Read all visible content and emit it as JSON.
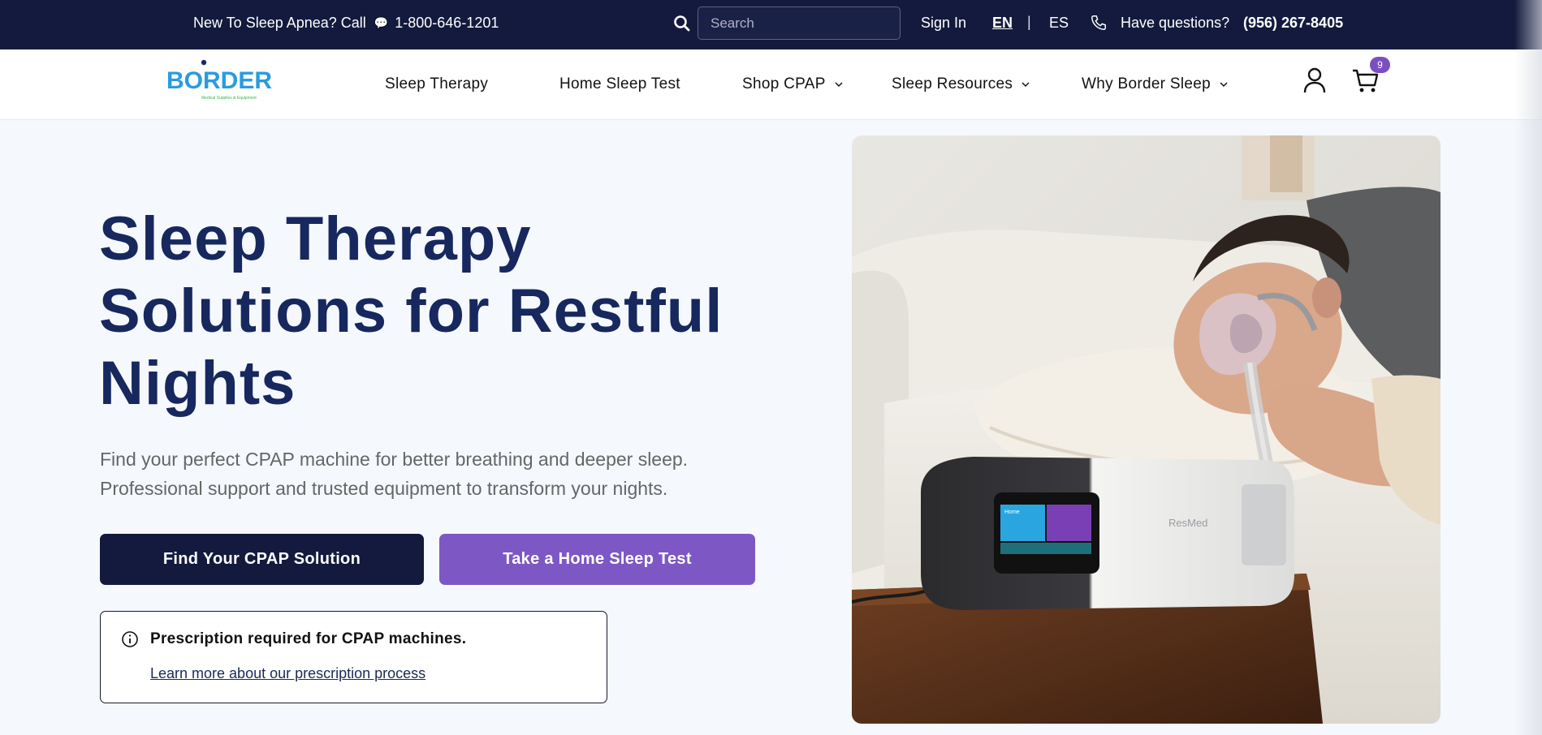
{
  "topbar": {
    "promo_text": "New To Sleep Apnea? Call",
    "promo_phone": "1-800-646-1201",
    "search_placeholder": "Search",
    "sign_in": "Sign In",
    "lang_en": "EN",
    "lang_sep": "|",
    "lang_es": "ES",
    "questions_text": "Have questions?",
    "questions_phone": "(956) 267-8405"
  },
  "nav": {
    "logo_text": "BORDER",
    "logo_tagline": "Medical Supplies & Equipment",
    "items": [
      {
        "label": "Sleep Therapy"
      },
      {
        "label": "Home Sleep Test"
      },
      {
        "label": "Shop CPAP"
      },
      {
        "label": "Sleep Resources"
      },
      {
        "label": "Why Border Sleep"
      }
    ],
    "cart_count": "9"
  },
  "hero": {
    "title_line1": "Sleep Therapy",
    "title_line2": "Solutions for Restful",
    "title_line3": "Nights",
    "subtitle_line1": "Find your perfect CPAP machine for better breathing and deeper sleep.",
    "subtitle_line2": "Professional support and trusted equipment to transform your nights.",
    "primary_cta": "Find Your CPAP Solution",
    "secondary_cta": "Take a Home Sleep Test",
    "notice_title": "Prescription required for CPAP machines.",
    "notice_link": "Learn more about our prescription process",
    "image_brand_text": "ResMed",
    "image_screen_label": "Home"
  },
  "colors": {
    "topbar_bg": "#131a3d",
    "title": "#17285e",
    "primary_button": "#131a3d",
    "secondary_button": "#7d58c4",
    "badge": "#7b4fc2",
    "logo_blue": "#2a9be0"
  }
}
